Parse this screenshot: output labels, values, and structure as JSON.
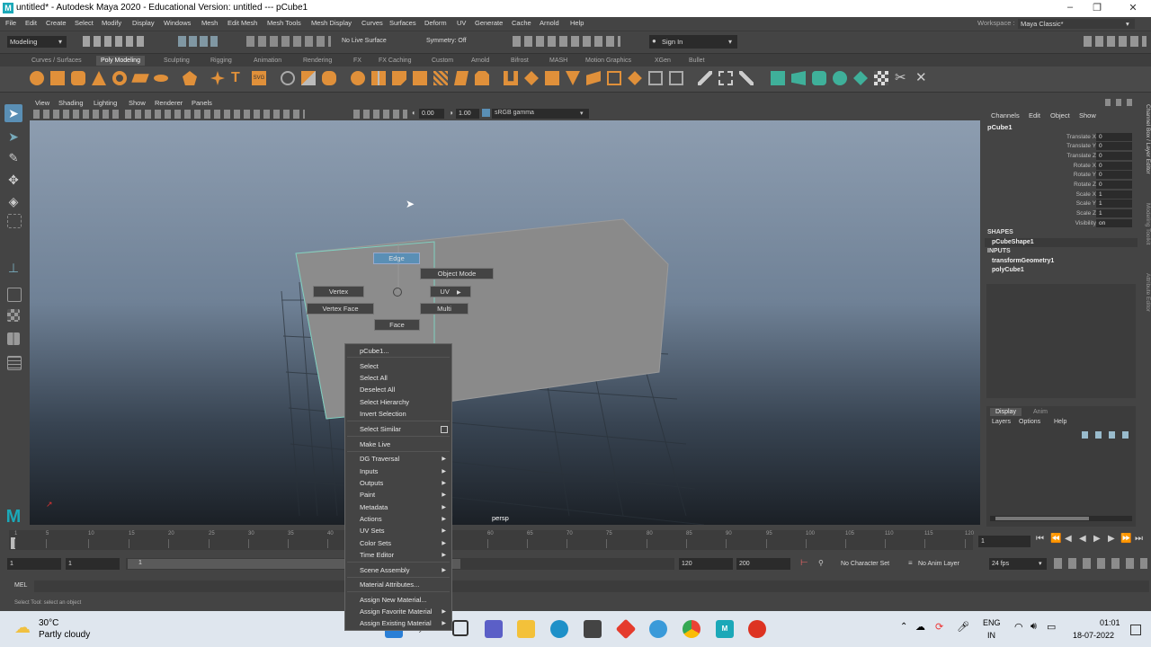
{
  "window": {
    "title": "untitled* - Autodesk Maya 2020 - Educational Version: untitled   ---   pCube1",
    "minimize": "–",
    "maximize": "❐",
    "close": "✕"
  },
  "menu": [
    "File",
    "Edit",
    "Create",
    "Select",
    "Modify",
    "Display",
    "Windows",
    "Mesh",
    "Edit Mesh",
    "Mesh Tools",
    "Mesh Display",
    "Curves",
    "Surfaces",
    "Deform",
    "UV",
    "Generate",
    "Cache",
    "Arnold",
    "Help"
  ],
  "workspace": {
    "label": "Workspace :",
    "value": "Maya Classic*"
  },
  "status": {
    "mode": "Modeling",
    "live_surface": "No Live Surface",
    "symmetry": "Symmetry: Off",
    "sign_in": "Sign In"
  },
  "shelf_tabs": [
    "Curves / Surfaces",
    "Poly Modeling",
    "Sculpting",
    "Rigging",
    "Animation",
    "Rendering",
    "FX",
    "FX Caching",
    "Custom",
    "Arnold",
    "Bifrost",
    "MASH",
    "Motion Graphics",
    "XGen",
    "Bullet"
  ],
  "panel_menu": [
    "View",
    "Shading",
    "Lighting",
    "Show",
    "Renderer",
    "Panels"
  ],
  "panel_toolbar": {
    "exposure": "0.00",
    "gamma": "1.00",
    "colorspace": "sRGB gamma"
  },
  "viewport": {
    "camera_label": "persp"
  },
  "marking_menu": {
    "edge": "Edge",
    "object_mode": "Object Mode",
    "vertex": "Vertex",
    "uv": "UV",
    "vertex_face": "Vertex Face",
    "multi": "Multi",
    "face": "Face"
  },
  "context_menu": [
    "pCube1...",
    "Select",
    "Select All",
    "Deselect All",
    "Select Hierarchy",
    "Invert Selection",
    "Select Similar",
    "Make Live",
    "DG Traversal",
    "Inputs",
    "Outputs",
    "Paint",
    "Metadata",
    "Actions",
    "UV Sets",
    "Color Sets",
    "Time Editor",
    "Scene Assembly",
    "Material Attributes...",
    "Assign New Material...",
    "Assign Favorite Material",
    "Assign Existing Material"
  ],
  "channel_box": {
    "tabs": [
      "Channels",
      "Edit",
      "Object",
      "Show"
    ],
    "object": "pCube1",
    "attrs": [
      {
        "name": "Translate X",
        "value": "0"
      },
      {
        "name": "Translate Y",
        "value": "0"
      },
      {
        "name": "Translate Z",
        "value": "0"
      },
      {
        "name": "Rotate X",
        "value": "0"
      },
      {
        "name": "Rotate Y",
        "value": "0"
      },
      {
        "name": "Rotate Z",
        "value": "0"
      },
      {
        "name": "Scale X",
        "value": "1"
      },
      {
        "name": "Scale Y",
        "value": "1"
      },
      {
        "name": "Scale Z",
        "value": "1"
      },
      {
        "name": "Visibility",
        "value": "on"
      }
    ],
    "shapes_header": "SHAPES",
    "shape": "pCubeShape1",
    "inputs_header": "INPUTS",
    "inputs": [
      "transformGeometry1",
      "polyCube1"
    ]
  },
  "layer_editor": {
    "tabs": [
      "Display",
      "Anim"
    ],
    "menu": [
      "Layers",
      "Options",
      "Help"
    ]
  },
  "side_tabs": [
    "Channel Box / Layer Editor",
    "Modeling Toolkit",
    "Attribute Editor"
  ],
  "timeline": {
    "ticks": [
      "1",
      "5",
      "10",
      "15",
      "20",
      "25",
      "30",
      "35",
      "40",
      "60",
      "65",
      "70",
      "75",
      "80",
      "85",
      "90",
      "95",
      "100",
      "105",
      "110",
      "115",
      "120"
    ],
    "current_frame": "1"
  },
  "range": {
    "start": "1",
    "start_inner": "1",
    "range_label": "1",
    "end_inner": "120",
    "end": "200",
    "char_set": "No Character Set",
    "anim_layer": "No Anim Layer",
    "fps": "24 fps"
  },
  "command_line": {
    "label": "MEL"
  },
  "help_line": "Select Tool: select an object",
  "taskbar": {
    "temp": "30°C",
    "weather": "Partly cloudy",
    "lang1": "ENG",
    "lang2": "IN",
    "time": "01:01",
    "date": "18-07-2022"
  },
  "colors": {
    "accent": "#5a8fb5",
    "maya_teal": "#1ba8b8",
    "shelf_orange": "#e0903a",
    "shelf_teal": "#3fb09a"
  }
}
